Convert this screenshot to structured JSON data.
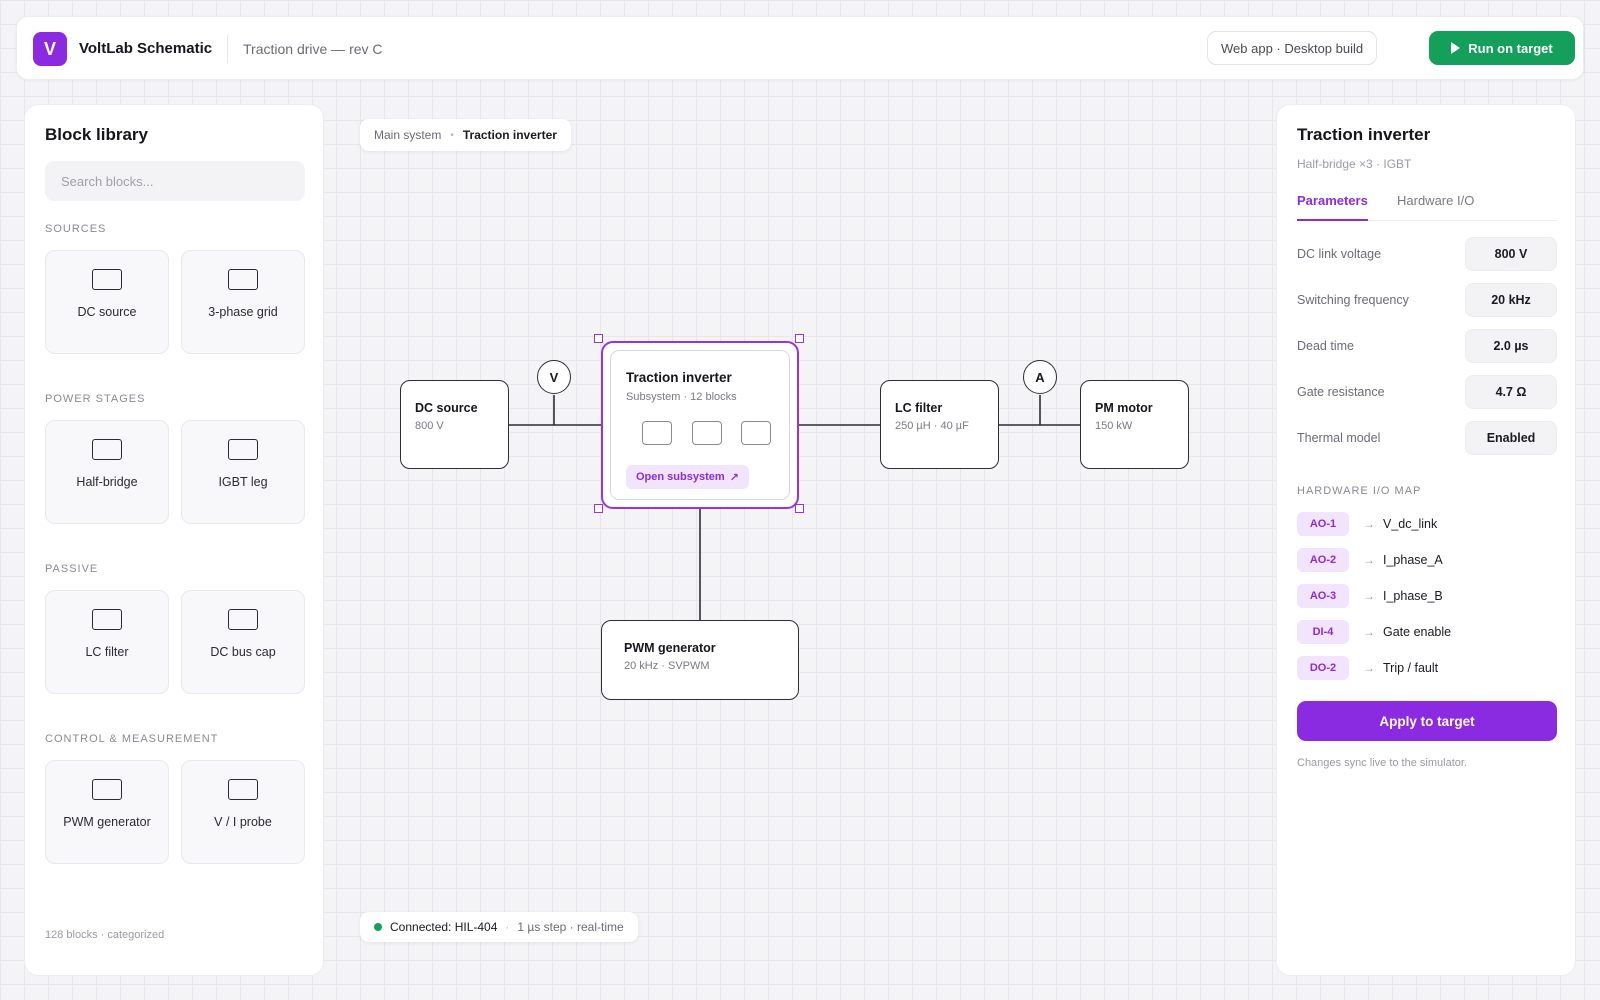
{
  "header": {
    "logo_letter": "V",
    "app_title": "VoltLab Schematic",
    "doc_title": "Traction drive — rev C",
    "mode_button": "Web app · Desktop build",
    "run_button": "Run on target"
  },
  "library": {
    "title": "Block library",
    "search_placeholder": "Search blocks...",
    "sections": [
      {
        "label": "SOURCES",
        "items": [
          "DC source",
          "3-phase grid"
        ]
      },
      {
        "label": "POWER STAGES",
        "items": [
          "Half-bridge",
          "IGBT leg"
        ]
      },
      {
        "label": "PASSIVE",
        "items": [
          "LC filter",
          "DC bus cap"
        ]
      },
      {
        "label": "CONTROL & MEASUREMENT",
        "items": [
          "PWM generator",
          "V / I probe"
        ]
      }
    ],
    "footer": "128 blocks · categorized"
  },
  "canvas": {
    "breadcrumb": {
      "root": "Main system",
      "separator": "•",
      "current": "Traction inverter"
    },
    "blocks": {
      "dc_source": {
        "title": "DC source",
        "sub": "800 V"
      },
      "inverter": {
        "title": "Traction inverter",
        "sub": "Subsystem · 12 blocks",
        "open_label": "Open subsystem",
        "open_icon": "↗"
      },
      "lc_filter": {
        "title": "LC filter",
        "sub": "250 µH · 40 µF"
      },
      "pm_motor": {
        "title": "PM motor",
        "sub": "150 kW"
      },
      "pwm": {
        "title": "PWM generator",
        "sub": "20 kHz · SVPWM"
      }
    },
    "meters": {
      "voltage": "V",
      "current": "A"
    },
    "status": {
      "main": "Connected: HIL-404",
      "separator": "·",
      "detail": "1 µs step · real-time"
    }
  },
  "inspector": {
    "title": "Traction inverter",
    "subtitle": "Half-bridge ×3 · IGBT",
    "tabs": [
      "Parameters",
      "Hardware I/O"
    ],
    "params": [
      {
        "label": "DC link voltage",
        "value": "800 V"
      },
      {
        "label": "Switching frequency",
        "value": "20 kHz"
      },
      {
        "label": "Dead time",
        "value": "2.0 µs"
      },
      {
        "label": "Gate resistance",
        "value": "4.7 Ω"
      },
      {
        "label": "Thermal model",
        "value": "Enabled"
      }
    ],
    "hw_section_label": "HARDWARE I/O MAP",
    "io_arrow": "→",
    "io_map": [
      {
        "pin": "AO-1",
        "signal": "V_dc_link"
      },
      {
        "pin": "AO-2",
        "signal": "I_phase_A"
      },
      {
        "pin": "AO-3",
        "signal": "I_phase_B"
      },
      {
        "pin": "DI-4",
        "signal": "Gate enable"
      },
      {
        "pin": "DO-2",
        "signal": "Trip / fault"
      }
    ],
    "apply_button": "Apply to target",
    "footer": "Changes sync live to the simulator."
  },
  "colors": {
    "accent": "#8a2be2",
    "run_green": "#14a05a",
    "badge_bg": "#f1e4fc"
  }
}
